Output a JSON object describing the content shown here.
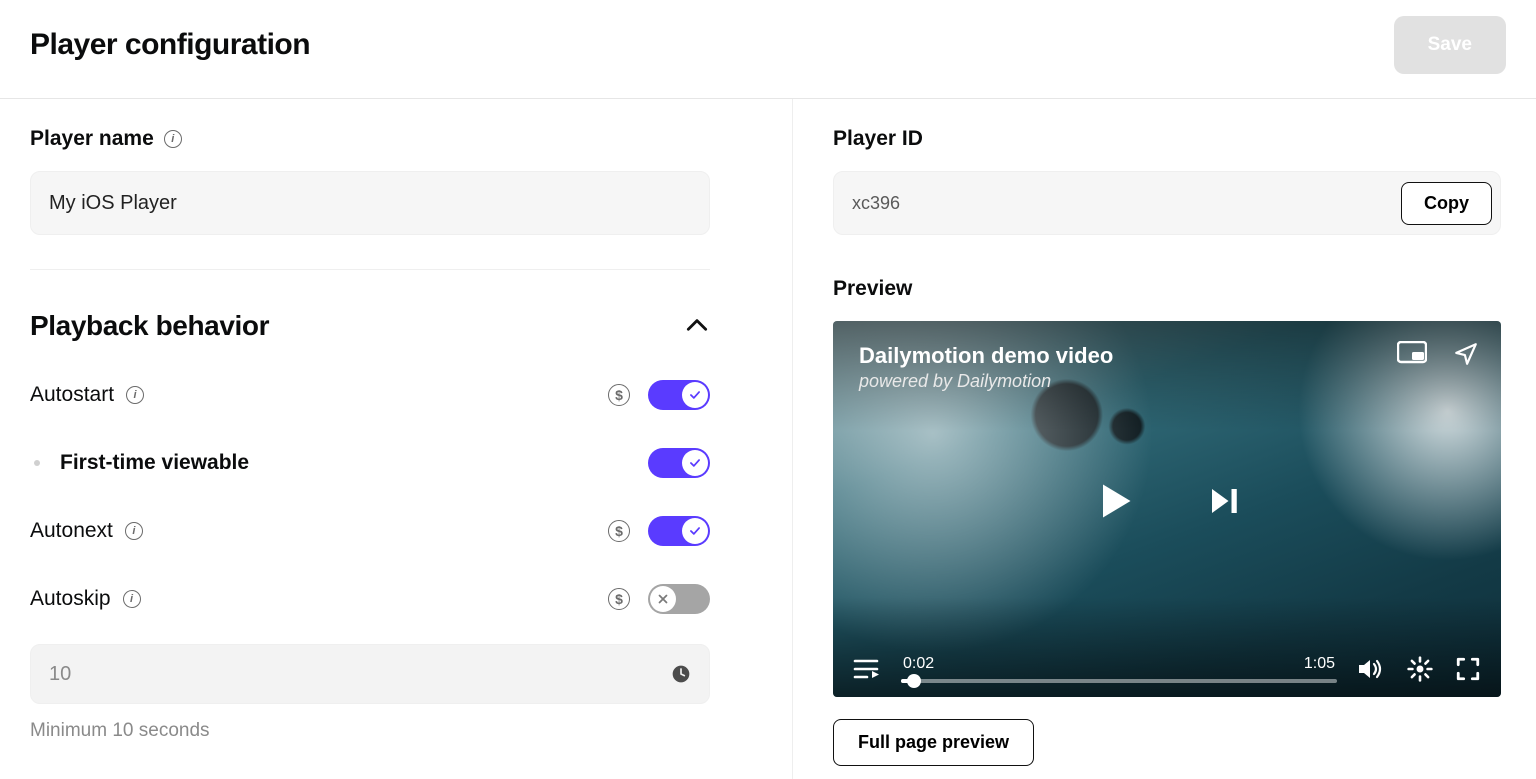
{
  "header": {
    "title": "Player configuration",
    "save_label": "Save"
  },
  "player_name": {
    "label": "Player name",
    "value": "My iOS Player"
  },
  "playback": {
    "section_title": "Playback behavior",
    "autostart": {
      "label": "Autostart",
      "on": true
    },
    "first_viewable": {
      "label": "First-time viewable",
      "on": true
    },
    "autonext": {
      "label": "Autonext",
      "on": true
    },
    "autoskip": {
      "label": "Autoskip",
      "on": false
    },
    "skip_value": "10",
    "skip_helper": "Minimum 10 seconds"
  },
  "player_id": {
    "label": "Player ID",
    "value": "xc396",
    "copy_label": "Copy"
  },
  "preview": {
    "label": "Preview",
    "video_title": "Dailymotion demo video",
    "video_subtitle": "powered by Dailymotion",
    "elapsed": "0:02",
    "duration": "1:05",
    "full_page_button": "Full page preview"
  }
}
